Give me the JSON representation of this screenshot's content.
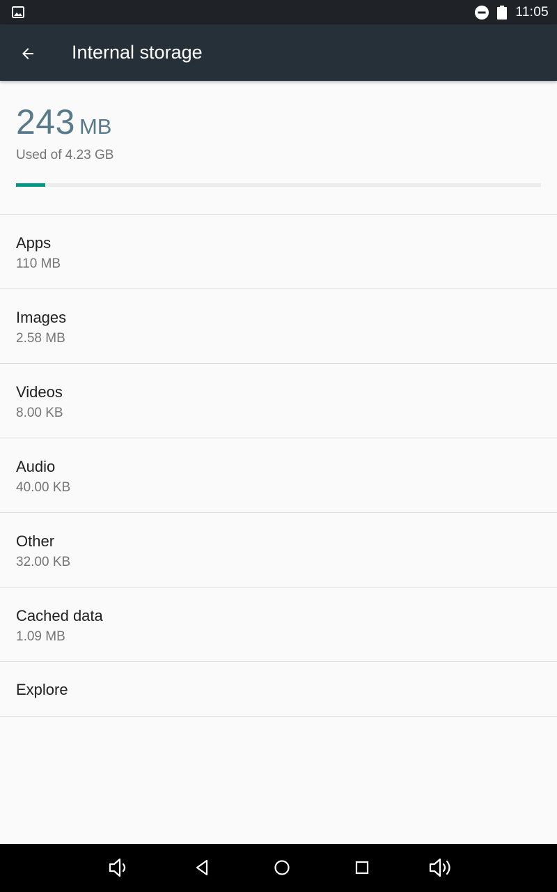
{
  "status_bar": {
    "time": "11:05",
    "icons": [
      "image-notification-icon",
      "do-not-disturb-icon",
      "battery-icon"
    ]
  },
  "app_bar": {
    "title": "Internal storage",
    "back_icon": "arrow-back-icon"
  },
  "summary": {
    "used_value": "243",
    "used_unit": "MB",
    "used_of": "Used of 4.23 GB",
    "used_fraction": 0.056,
    "accent_color": "#009688"
  },
  "items": [
    {
      "title": "Apps",
      "size": "110 MB"
    },
    {
      "title": "Images",
      "size": "2.58 MB"
    },
    {
      "title": "Videos",
      "size": "8.00 KB"
    },
    {
      "title": "Audio",
      "size": "40.00 KB"
    },
    {
      "title": "Other",
      "size": "32.00 KB"
    },
    {
      "title": "Cached data",
      "size": "1.09 MB"
    },
    {
      "title": "Explore"
    }
  ],
  "nav_bar": {
    "icons": [
      "volume-down-icon",
      "back-triangle-icon",
      "home-circle-icon",
      "recents-square-icon",
      "volume-up-icon"
    ]
  }
}
